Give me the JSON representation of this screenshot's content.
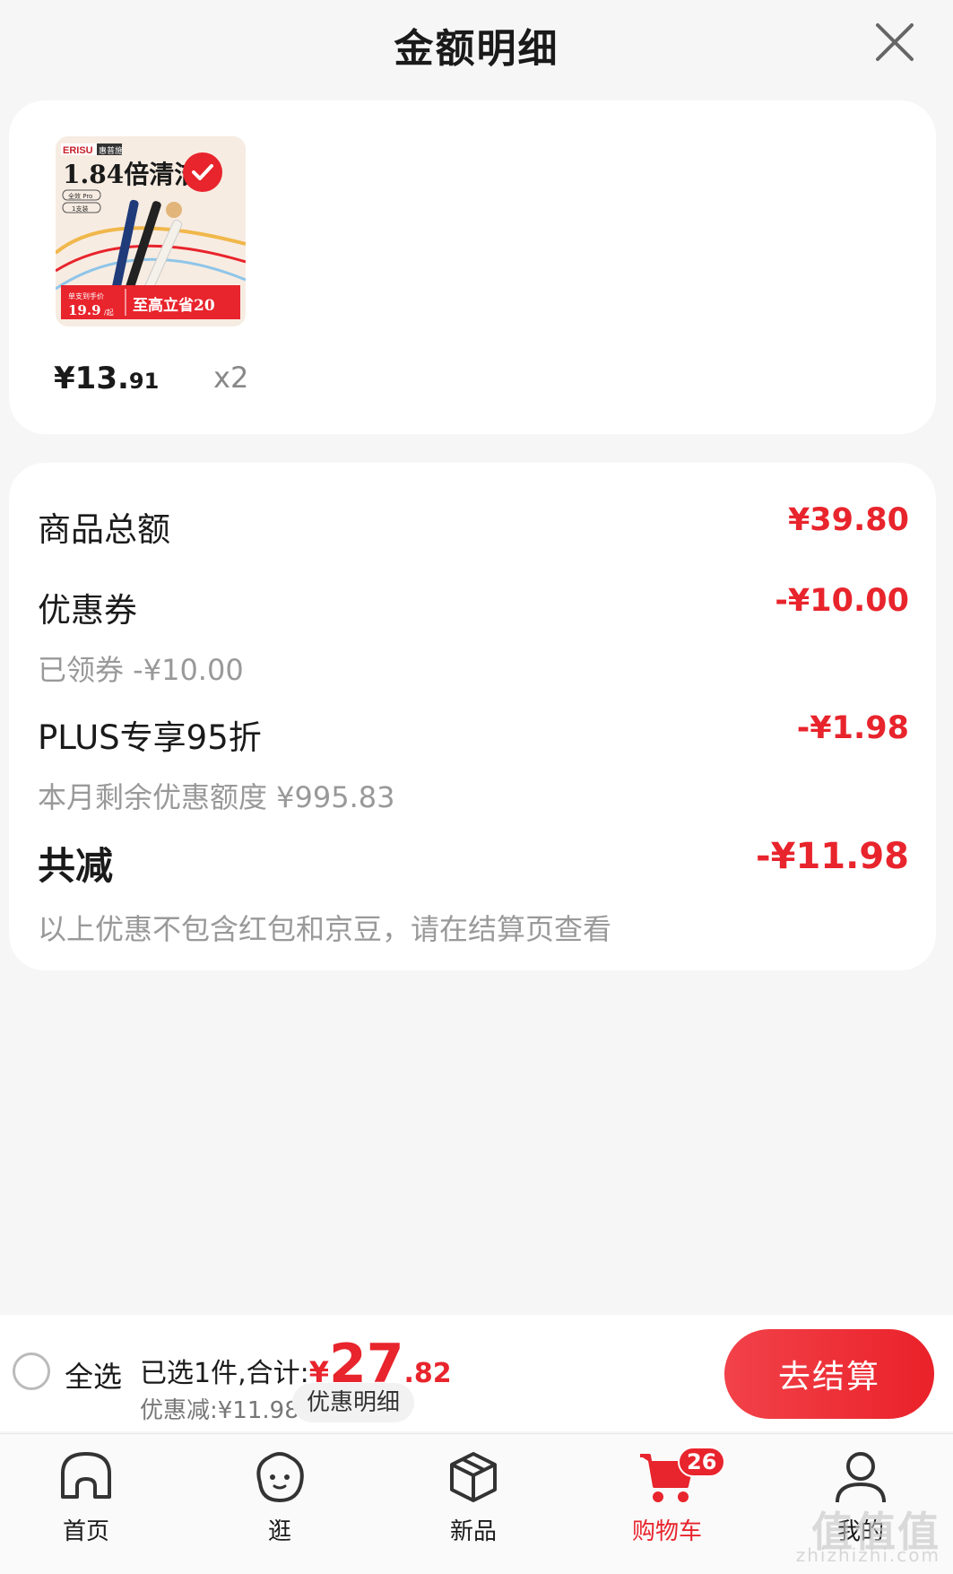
{
  "header": {
    "title": "金额明细"
  },
  "product": {
    "image": {
      "brand": "ERISU",
      "brand_tag": "惠普施",
      "headline": "1.84倍清洁",
      "spec1": "全效 Pro",
      "spec2": "1支装",
      "promo_label": "单支到手价",
      "promo_price": "19.9",
      "promo_unit": "/起",
      "promo_save": "至高立省20"
    },
    "price_int": "¥13.",
    "price_dec": "91",
    "quantity": "x2"
  },
  "summary": {
    "goods_total": {
      "label": "商品总额",
      "value": "¥39.80"
    },
    "coupon": {
      "label": "优惠券",
      "value": "-¥10.00",
      "sub": "已领券 -¥10.00"
    },
    "plus": {
      "label": "PLUS专享95折",
      "value": "-¥1.98",
      "sub": "本月剩余优惠额度 ¥995.83"
    },
    "total_discount": {
      "label": "共减",
      "value": "-¥11.98",
      "sub": "以上优惠不包含红包和京豆，请在结算页查看"
    }
  },
  "bottom_bar": {
    "select_all": "全选",
    "selected_text": "已选1件,合计:",
    "currency": "¥",
    "total_int": "27",
    "total_dec": ".82",
    "discount_text": "优惠减:¥11.98",
    "detail_button": "优惠明细",
    "checkout_button": "去结算"
  },
  "tabbar": {
    "items": [
      {
        "label": "首页",
        "icon": "home-icon"
      },
      {
        "label": "逛",
        "icon": "explore-icon"
      },
      {
        "label": "新品",
        "icon": "new-products-icon"
      },
      {
        "label": "购物车",
        "icon": "cart-icon",
        "badge": "26",
        "active": true
      },
      {
        "label": "我的",
        "icon": "profile-icon"
      }
    ]
  },
  "watermark": {
    "text": "值值值",
    "url": "zhizhizhi.com"
  },
  "colors": {
    "accent": "#e8242c",
    "muted": "#999999",
    "background": "#f6f6f6"
  }
}
